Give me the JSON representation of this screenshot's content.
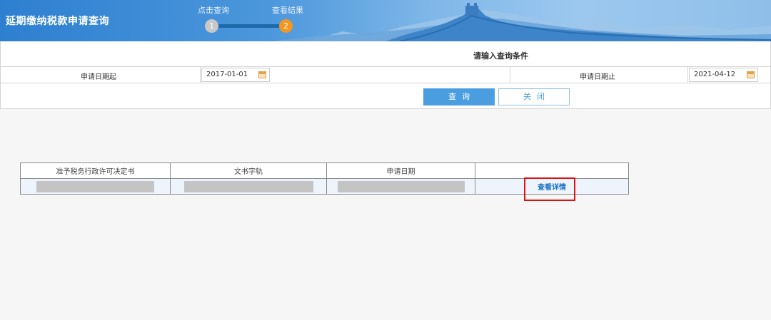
{
  "header": {
    "title": "延期缴纳税款申请查询",
    "steps": [
      {
        "label": "点击查询",
        "number": "1"
      },
      {
        "label": "查看结果",
        "number": "2"
      }
    ]
  },
  "query": {
    "title": "请输入查询条件",
    "start_label": "申请日期起",
    "start_value": "2017-01-01",
    "end_label": "申请日期止",
    "end_value": "2021-04-12",
    "query_button": "查询",
    "close_button": "关闭"
  },
  "results": {
    "columns": [
      "准予税务行政许可决定书",
      "文书字轨",
      "申请日期",
      ""
    ],
    "rows": [
      {
        "detail_link": "查看详情"
      }
    ]
  },
  "colors": {
    "accent": "#4a9ee0",
    "step_active": "#f5961e",
    "highlight": "#e01010"
  }
}
